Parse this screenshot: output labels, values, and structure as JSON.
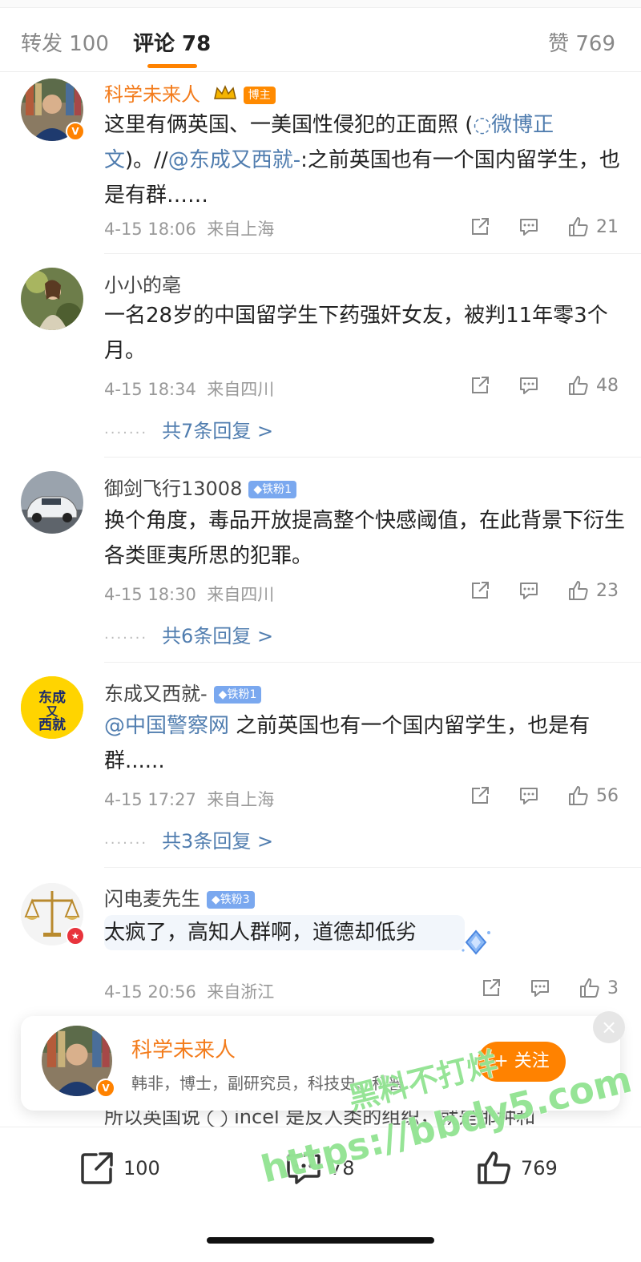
{
  "tabs": {
    "repost": "转发 100",
    "comment": "评论 78",
    "like": "赞 769"
  },
  "comments": [
    {
      "name": "科学未来人",
      "badge": "博主",
      "text_plain1": "这里有俩英国、一美国性侵犯的正面照 (",
      "text_link1": "微博正文",
      "text_plain2": ")。//",
      "text_link2": "@东成又西就-",
      "text_plain3": ":之前英国也有一个国内留学生，也是有群……",
      "time": "4-15 18:06",
      "location": "来自上海",
      "likes": "21"
    },
    {
      "name": "小小的亳",
      "text": "一名28岁的中国留学生下药强奸女友，被判11年零3个月。",
      "time": "4-15 18:34",
      "location": "来自四川",
      "likes": "48",
      "replies": "共7条回复 >"
    },
    {
      "name": "御剑飞行13008",
      "badge": "铁粉1",
      "text": "换个角度，毒品开放提高整个快感阈值，在此背景下衍生各类匪夷所思的犯罪。",
      "time": "4-15 18:30",
      "location": "来自四川",
      "likes": "23",
      "replies": "共6条回复 >"
    },
    {
      "name": "东成又西就-",
      "badge": "铁粉1",
      "text_link": "@中国警察网",
      "text_plain": " 之前英国也有一个国内留学生，也是有群......",
      "time": "4-15 17:27",
      "location": "来自上海",
      "likes": "56",
      "replies": "共3条回复 >",
      "avatar_text": "东成又西就"
    },
    {
      "name": "闪电麦先生",
      "badge": "铁粉3",
      "text": "太疯了，高知人群啊，道德却低劣",
      "time": "4-15 20:56",
      "location": "来自浙江",
      "likes": "3"
    }
  ],
  "popup": {
    "name": "科学未来人",
    "desc": "韩非，博士，副研究员，科技史、科普",
    "follow": "+ 关注",
    "close": "×"
  },
  "underlay_text": "所以英国说 ◯ incel 是反人类的组织，就是那种和",
  "bottom": {
    "repost": "100",
    "comment": "78",
    "like": "769"
  },
  "watermark": {
    "line1": "黑料不打烊",
    "line2": "https://bbdy5.com"
  },
  "colors": {
    "accent": "#ff8200",
    "link": "#507daf",
    "username_highlight": "#f37c1c"
  }
}
